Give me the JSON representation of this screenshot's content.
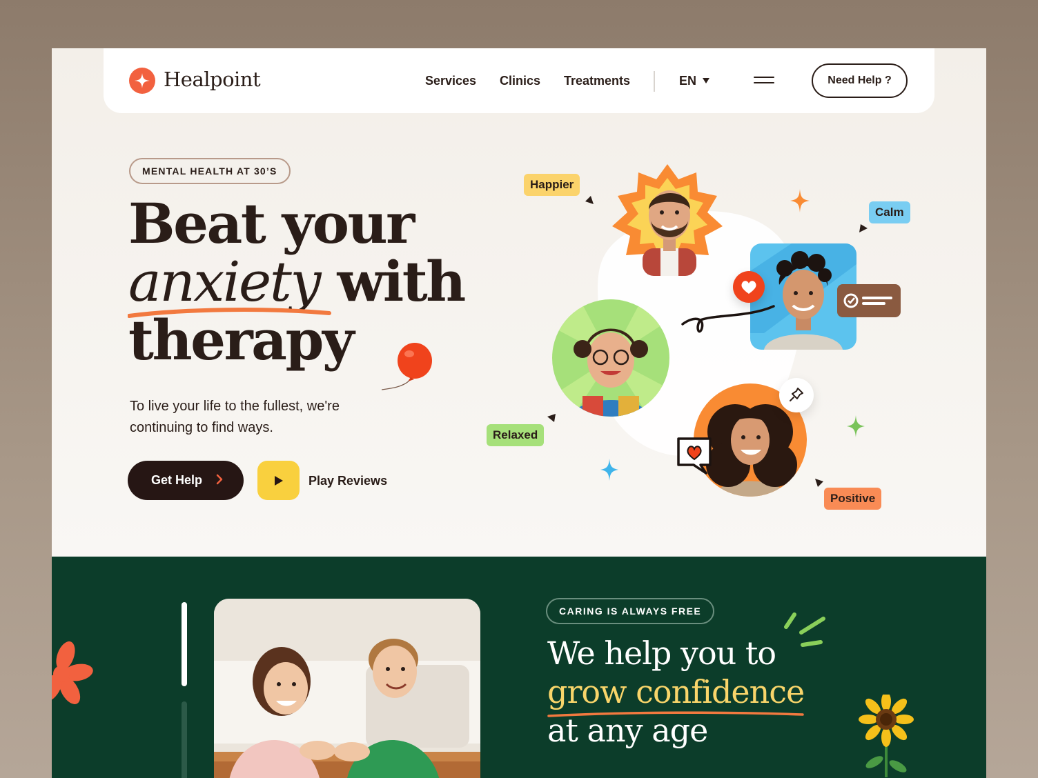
{
  "brand": {
    "name": "Healpoint",
    "accent": "#f2613f",
    "dark": "#261614",
    "green": "#0c3d2a",
    "yellow": "#f9d03e"
  },
  "nav": {
    "links": [
      "Services",
      "Clinics",
      "Treatments"
    ],
    "language": "EN",
    "menu_icon": "hamburger-icon",
    "help_button": "Need Help ?"
  },
  "hero": {
    "tag": "MENTAL HEALTH AT 30’S",
    "headline_line1": "Beat your",
    "headline_italic": "anxiety",
    "headline_line2_rest": "with",
    "headline_line3": "therapy",
    "subtitle": "To live your life to the fullest, we're continuing to find ways.",
    "cta_primary": "Get Help",
    "cta_secondary": "Play Reviews"
  },
  "moods": {
    "happier": "Happier",
    "calm": "Calm",
    "relaxed": "Relaxed",
    "positive": "Positive"
  },
  "section2": {
    "tag": "CARING IS ALWAYS FREE",
    "line1": "We help you to",
    "line2": "grow confidence",
    "line3": "at any age"
  }
}
